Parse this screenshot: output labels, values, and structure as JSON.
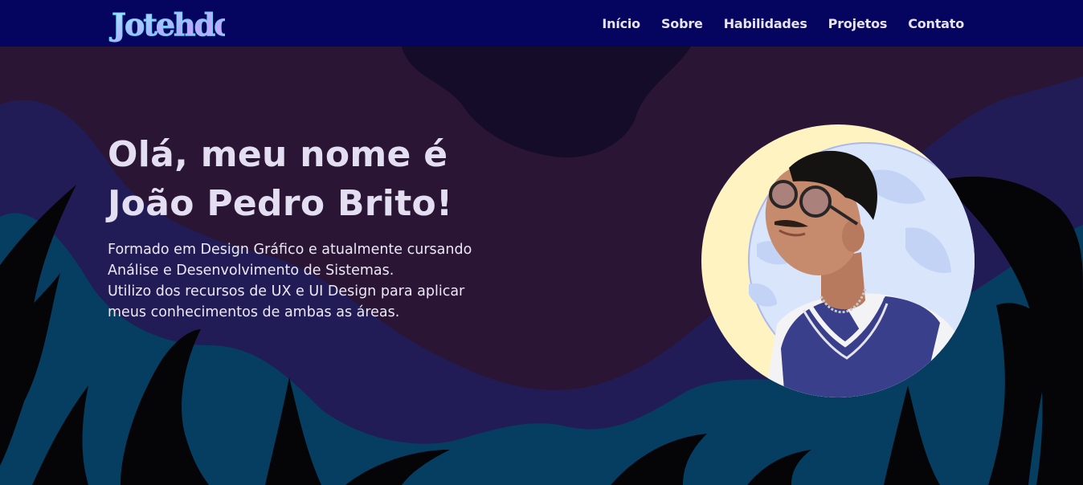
{
  "navbar": {
    "logo_text": "Jotehdo",
    "links": [
      "Início",
      "Sobre",
      "Habilidades",
      "Projetos",
      "Contato"
    ]
  },
  "hero": {
    "title_lines": [
      "Olá, meu nome é",
      "João Pedro Brito!"
    ],
    "description_lines": [
      "Formado em Design Gráfico e atualmente cursando",
      "Análise e Desenvolvimento de Sistemas.",
      "Utilizo dos recursos de UX e UI Design para aplicar",
      "meus conhecimentos de ambas as áreas."
    ]
  },
  "colors": {
    "navbar": "#05045e",
    "background_purple": "#2a1535",
    "background_indigo": "#221c56",
    "background_teal": "#063e62",
    "spikes": "#050508",
    "portrait_ring": "#fff3c2",
    "portrait_moon": "#d9e5fb",
    "text": "#e3def1"
  }
}
